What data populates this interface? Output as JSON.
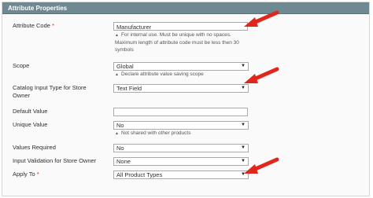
{
  "panel": {
    "title": "Attribute Properties"
  },
  "fields": {
    "attribute_code": {
      "label": "Attribute Code",
      "required_mark": "*",
      "value": "Manufacturer",
      "note_line1": "For internal use. Must be unique with no spaces.",
      "note_line2": "Maximum length of attribute code must be less then 30",
      "note_line3": "symbols"
    },
    "scope": {
      "label": "Scope",
      "value": "Global",
      "note": "Declare attribute value saving scope"
    },
    "input_type": {
      "label_line1": "Catalog Input Type for Store",
      "label_line2": "Owner",
      "value": "Text Field"
    },
    "default_value": {
      "label": "Default Value",
      "value": ""
    },
    "unique_value": {
      "label": "Unique Value",
      "value": "No",
      "note": "Not shared with other products"
    },
    "values_required": {
      "label": "Values Required",
      "value": "No"
    },
    "input_validation": {
      "label": "Input Validation for Store Owner",
      "value": "None"
    },
    "apply_to": {
      "label": "Apply To",
      "required_mark": "*",
      "value": "All Product Types"
    }
  },
  "colors": {
    "header_bg": "#6f8992",
    "required": "#e1261c",
    "arrow": "#e1261c"
  },
  "icons": {
    "caret": "chevron-down-icon",
    "note": "triangle-up-icon",
    "arrow": "red-arrow-icon"
  }
}
